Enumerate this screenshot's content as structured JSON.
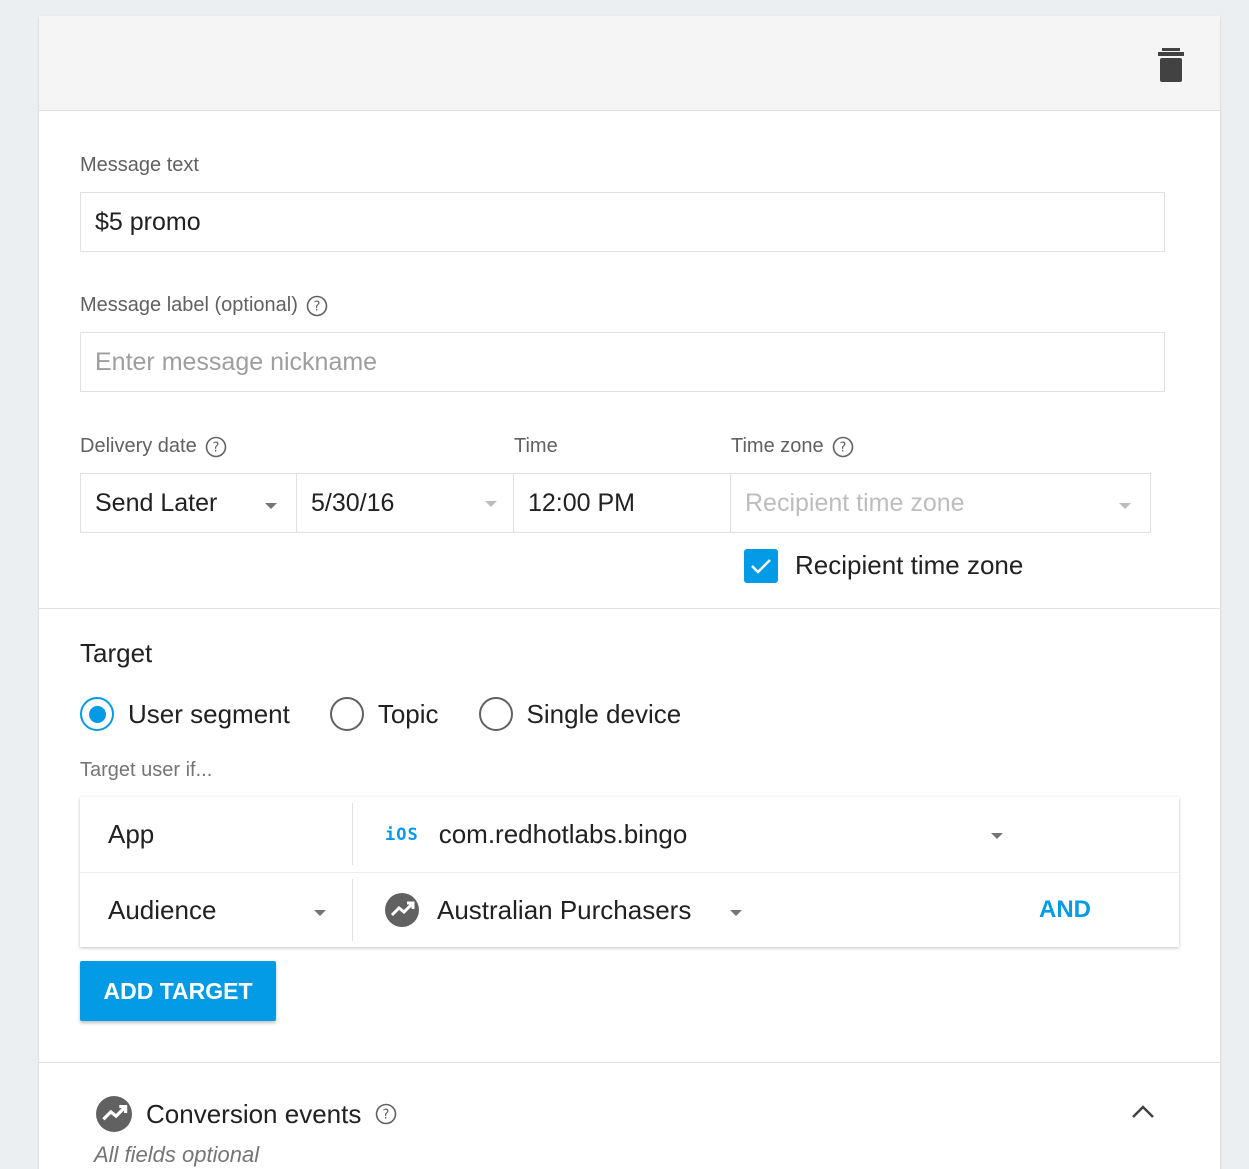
{
  "message": {
    "text_label": "Message text",
    "text_value": "$5 promo",
    "label_label": "Message label (optional)",
    "label_placeholder": "Enter message nickname"
  },
  "delivery": {
    "date_label": "Delivery date",
    "send_option": "Send Later",
    "date_value": "5/30/16",
    "time_label": "Time",
    "time_value": "12:00 PM",
    "timezone_label": "Time zone",
    "timezone_placeholder": "Recipient time zone",
    "recipient_tz_checkbox_label": "Recipient time zone",
    "recipient_tz_checked": true
  },
  "target": {
    "title": "Target",
    "options": [
      "User segment",
      "Topic",
      "Single device"
    ],
    "selected": "User segment",
    "condition_label": "Target user if...",
    "rows": [
      {
        "field": "App",
        "platform_badge": "iOS",
        "value": "com.redhotlabs.bingo"
      },
      {
        "field": "Audience",
        "value": "Australian Purchasers",
        "connector": "AND"
      }
    ],
    "add_button": "ADD TARGET"
  },
  "conversion": {
    "title": "Conversion events",
    "note": "All fields optional"
  },
  "icons": {
    "delete": "trash-icon",
    "help": "help-circle-icon",
    "analytics": "analytics-icon",
    "collapse": "chevron-up-icon"
  },
  "colors": {
    "accent": "#039be5",
    "background": "#eceff1"
  }
}
